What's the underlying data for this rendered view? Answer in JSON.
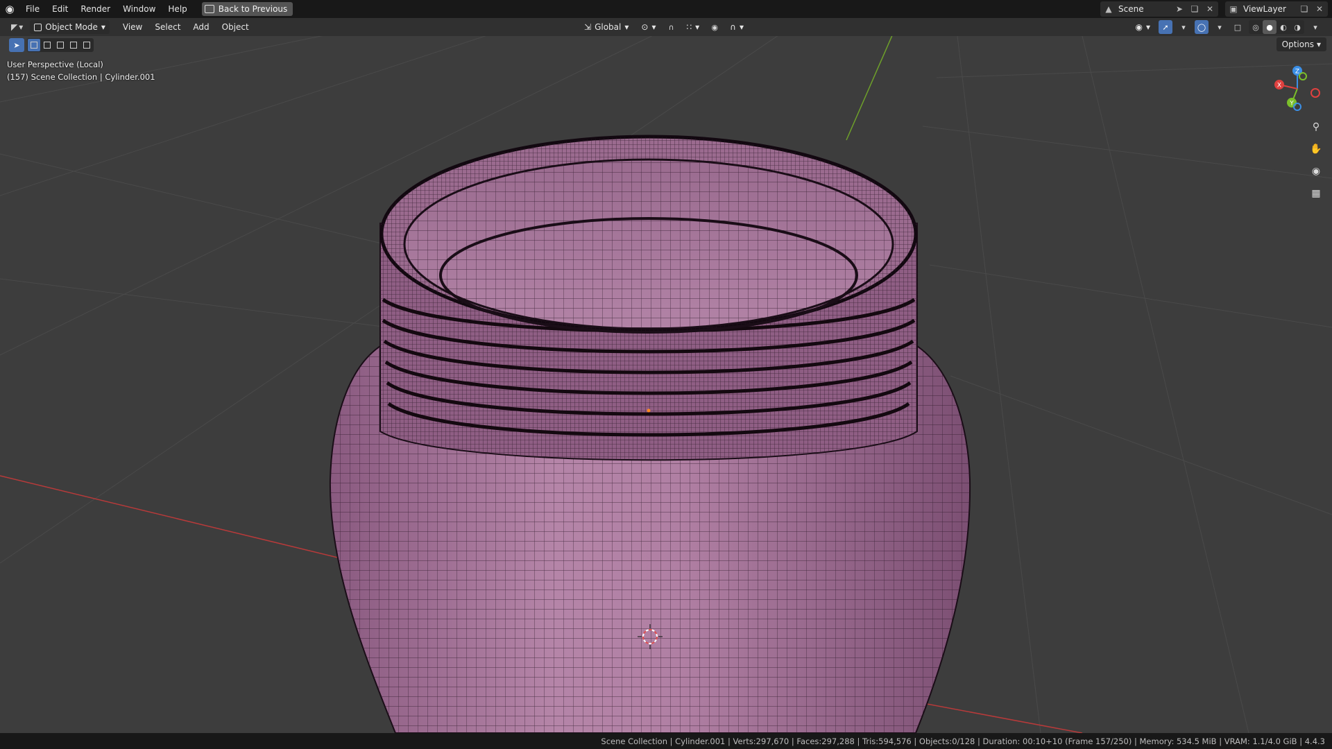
{
  "topbar": {
    "menu": [
      "File",
      "Edit",
      "Render",
      "Window",
      "Help"
    ],
    "back_button": "Back to Previous",
    "scene_name": "Scene",
    "view_layer": "ViewLayer"
  },
  "viewport_header": {
    "mode": "Object Mode",
    "menu": [
      "View",
      "Select",
      "Add",
      "Object"
    ],
    "transform_orientation": "Global"
  },
  "options_label": "Options",
  "overlay": {
    "view_name": "User Perspective (Local)",
    "collection_info": "(157) Scene Collection | Cylinder.001"
  },
  "gizmo": {
    "x_label": "X",
    "y_label": "Y",
    "z_label": "Z",
    "x_color": "#e0413f",
    "y_color": "#7bbf2a",
    "z_color": "#3b8fe6"
  },
  "object": {
    "name": "Cylinder.001",
    "color": "#a9749c"
  },
  "statusbar": {
    "text": "Scene Collection | Cylinder.001 | Verts:297,670 | Faces:297,288 | Tris:594,576 | Objects:0/128 | Duration: 00:10+10 (Frame 157/250) | Memory: 534.5 MiB | VRAM: 1.1/4.0 GiB | 4.4.3"
  }
}
